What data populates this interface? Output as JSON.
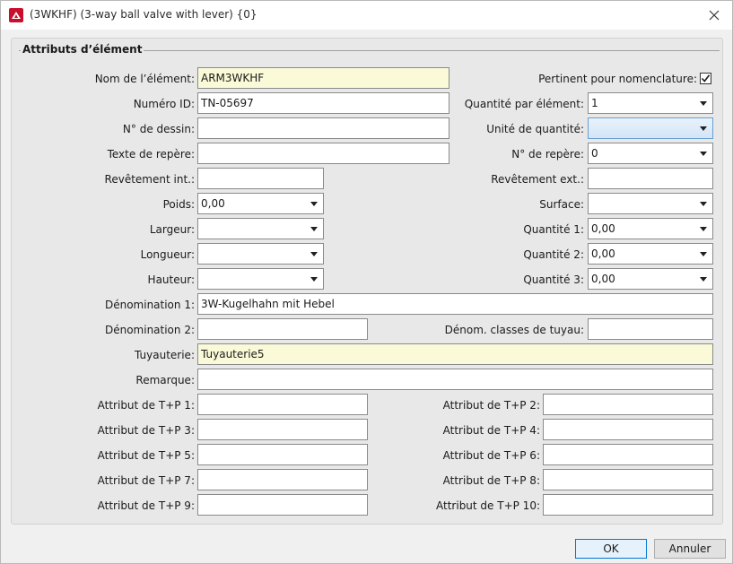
{
  "window": {
    "title": "(3WKHF) (3-way ball valve with lever) {0}"
  },
  "group": {
    "title": "Attributs d’élément"
  },
  "left": {
    "nom_label": "Nom de l’élément:",
    "nom_value": "ARM3WKHF",
    "numero_label": "Numéro ID:",
    "numero_value": "TN-05697",
    "dessin_label": "N° de dessin:",
    "dessin_value": "",
    "texte_label": "Texte de repère:",
    "texte_value": "",
    "revint_label": "Revêtement int.:",
    "revint_value": "",
    "poids_label": "Poids:",
    "poids_value": "0,00",
    "largeur_label": "Largeur:",
    "largeur_value": "",
    "longueur_label": "Longueur:",
    "longueur_value": "",
    "hauteur_label": "Hauteur:",
    "hauteur_value": "",
    "denom1_label": "Dénomination 1:",
    "denom1_value": "3W-Kugelhahn mit Hebel",
    "denom2_label": "Dénomination 2:",
    "denom2_value": "",
    "tuyauterie_label": "Tuyauterie:",
    "tuyauterie_value": "Tuyauterie5",
    "remarque_label": "Remarque:",
    "remarque_value": ""
  },
  "right": {
    "pertinent_label": "Pertinent pour nomenclature:",
    "pertinent_checked": true,
    "qte_elem_label": "Quantité par élément:",
    "qte_elem_value": "1",
    "unite_label": "Unité de quantité:",
    "unite_value": "",
    "repere_label": "N° de repère:",
    "repere_value": "0",
    "revext_label": "Revêtement ext.:",
    "revext_value": "",
    "surface_label": "Surface:",
    "surface_value": "",
    "qte1_label": "Quantité 1:",
    "qte1_value": "0,00",
    "qte2_label": "Quantité 2:",
    "qte2_value": "0,00",
    "qte3_label": "Quantité 3:",
    "qte3_value": "0,00",
    "denom_classes_label": "Dénom. classes de tuyau:",
    "denom_classes_value": ""
  },
  "tp": [
    {
      "label": "Attribut de T+P 1:",
      "value": ""
    },
    {
      "label": "Attribut de T+P 2:",
      "value": ""
    },
    {
      "label": "Attribut de T+P 3:",
      "value": ""
    },
    {
      "label": "Attribut de T+P 4:",
      "value": ""
    },
    {
      "label": "Attribut de T+P 5:",
      "value": ""
    },
    {
      "label": "Attribut de T+P 6:",
      "value": ""
    },
    {
      "label": "Attribut de T+P 7:",
      "value": ""
    },
    {
      "label": "Attribut de T+P 8:",
      "value": ""
    },
    {
      "label": "Attribut de T+P 9:",
      "value": ""
    },
    {
      "label": "Attribut de T+P 10:",
      "value": ""
    }
  ],
  "buttons": {
    "ok": "OK",
    "cancel": "Annuler"
  },
  "colors": {
    "required_field": "#fbfad8",
    "focus_accent": "#0078d7"
  }
}
